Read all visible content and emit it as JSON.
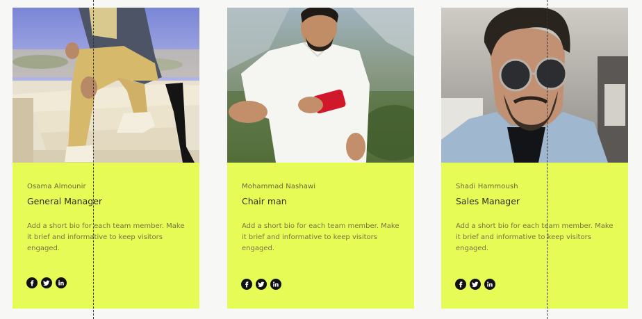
{
  "team": [
    {
      "name": "Osama Almounir",
      "role": "General Manager",
      "bio": "Add a short bio for each team member. Make it brief and informative to keep visitors engaged.",
      "photo": "man-sitting-on-steps-photo",
      "socials": [
        "facebook-icon",
        "twitter-icon",
        "linkedin-icon"
      ]
    },
    {
      "name": "Mohammad Nashawi",
      "role": "Chair man",
      "bio": "Add a short bio for each team member. Make it brief and informative to keep visitors engaged.",
      "photo": "man-with-phone-photo",
      "socials": [
        "facebook-icon",
        "twitter-icon",
        "linkedin-icon"
      ]
    },
    {
      "name": "Shadi Hammoush",
      "role": "Sales Manager",
      "bio": "Add a short bio for each team member. Make it brief and informative to keep visitors engaged.",
      "photo": "man-with-sunglasses-in-car-photo",
      "socials": [
        "facebook-icon",
        "twitter-icon",
        "linkedin-icon"
      ]
    }
  ],
  "colors": {
    "card_bg": "#e6fb55",
    "page_bg": "#f7f8f5",
    "icon_bg": "#111111"
  }
}
